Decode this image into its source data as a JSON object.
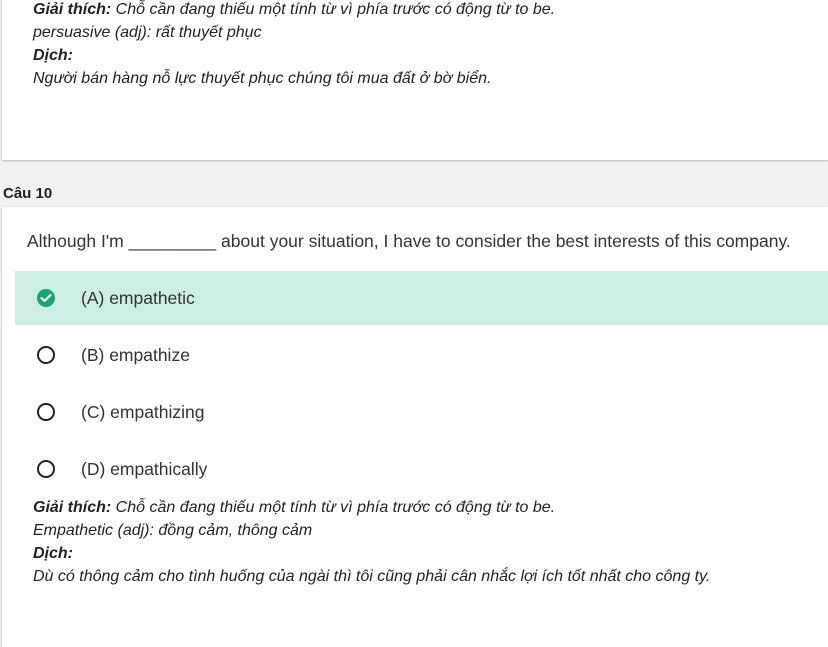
{
  "previous_question": {
    "explanation": {
      "label": "Giải thích:",
      "text": " Chỗ cần đang thiếu một tính từ vì phía trước có động từ to be.",
      "vocab": "persuasive (adj): rất thuyết phục",
      "translation_label": "Dịch:",
      "translation": "Người bán hàng nỗ lực thuyết phục chúng tôi mua đất ở bờ biển."
    }
  },
  "question": {
    "label": "Câu 10",
    "text": "Although I'm _________ about your situation, I have to consider the best interests of this company.",
    "options": [
      {
        "label": "(A) empathetic",
        "selected": true,
        "correct": true
      },
      {
        "label": "(B) empathize",
        "selected": false
      },
      {
        "label": "(C) empathizing",
        "selected": false
      },
      {
        "label": "(D) empathically",
        "selected": false
      }
    ],
    "explanation": {
      "label": "Giải thích:",
      "text": " Chỗ cần đang thiếu một tính từ vì phía trước có động từ to be.",
      "vocab": "Empathetic (adj): đồng cảm, thông cảm",
      "translation_label": "Dịch:",
      "translation": "Dù có thông cảm cho tình huống của ngài thì tôi cũng phải cân nhắc lợi ích tốt nhất cho công ty."
    }
  },
  "colors": {
    "correct_bg": "#cdeee5",
    "check_green": "#17a673"
  },
  "icons": {
    "correct": "check-circle-icon",
    "unselected": "radio-empty-icon"
  }
}
